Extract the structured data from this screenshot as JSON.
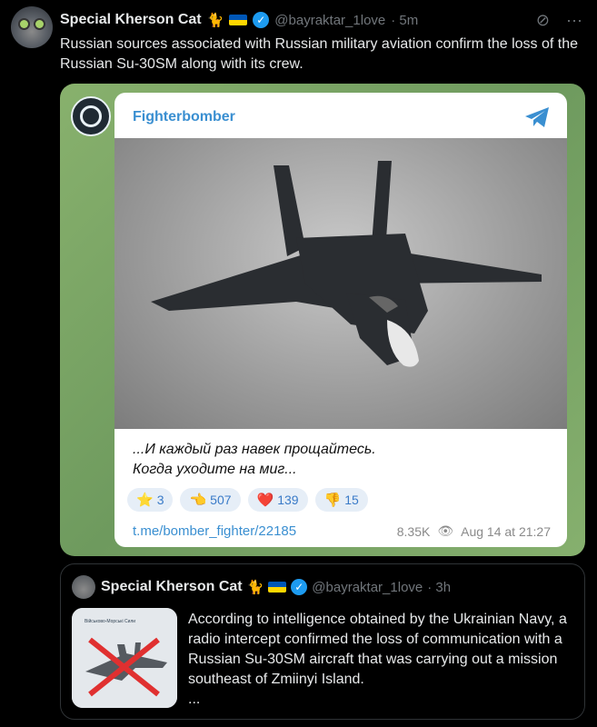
{
  "tweet": {
    "author_name": "Special Kherson Cat",
    "author_emoji": "🐈",
    "handle": "@bayraktar_1love",
    "time": "· 5m",
    "text": "Russian sources associated with Russian military aviation confirm the loss of the Russian Su-30SM along with its crew."
  },
  "telegram_card": {
    "channel": "Fighterbomber",
    "caption_line1": "...И каждый раз навек прощайтесь.",
    "caption_line2": "Когда уходите на миг...",
    "reactions": [
      {
        "icon": "⭐",
        "count": "3"
      },
      {
        "icon": "👈",
        "count": "507"
      },
      {
        "icon": "❤️",
        "count": "139"
      },
      {
        "icon": "👎",
        "count": "15"
      }
    ],
    "link": "t.me/bomber_fighter/22185",
    "views": "8.35K",
    "date": "Aug 14 at 21:27"
  },
  "quoted_tweet": {
    "author_name": "Special Kherson Cat",
    "author_emoji": "🐈",
    "handle": "@bayraktar_1love",
    "time": "· 3h",
    "thumb_label": "Військово-Морські Сили",
    "text": "According to intelligence obtained by the Ukrainian Navy, a radio intercept confirmed the loss of communication with a Russian Su-30SM aircraft that was carrying out a mission southeast of Zmiinyi Island.",
    "ellipsis": "..."
  },
  "colors": {
    "accent": "#1d9bf0",
    "tg_blue": "#3a8fd1",
    "muted": "#71767b"
  }
}
